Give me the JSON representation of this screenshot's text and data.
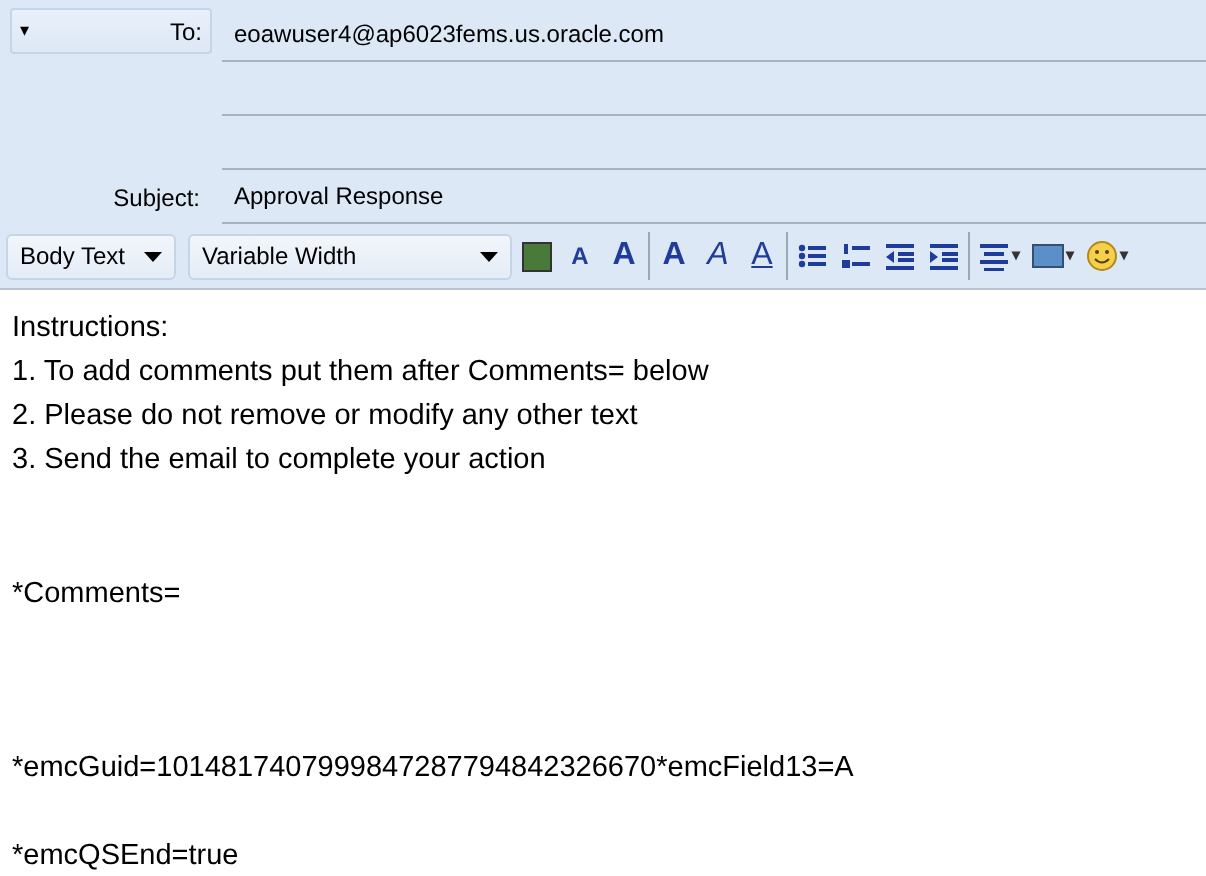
{
  "header": {
    "to_button": {
      "label": "To:",
      "caret": "▾"
    },
    "to_value": "eoawuser4@ap6023fems.us.oracle.com",
    "subject_label": "Subject:",
    "subject_value": "Approval Response"
  },
  "toolbar": [
    {
      "kind": "select",
      "label": "Body Text"
    },
    {
      "kind": "select",
      "label": "Variable Width"
    },
    {
      "kind": "color",
      "color": "#4a7a3a"
    },
    {
      "kind": "glyph",
      "label": "A"
    },
    {
      "kind": "glyph",
      "label": "A"
    },
    {
      "kind": "sep"
    },
    {
      "kind": "glyph",
      "label": "A"
    },
    {
      "kind": "glyph",
      "label": "A"
    },
    {
      "kind": "glyph",
      "label": "A"
    },
    {
      "kind": "sep"
    },
    {
      "kind": "icon"
    },
    {
      "kind": "icon"
    },
    {
      "kind": "icon"
    },
    {
      "kind": "icon"
    },
    {
      "kind": "sep"
    },
    {
      "kind": "icon",
      "caret": "▾"
    },
    {
      "kind": "icon",
      "caret": "▾"
    },
    {
      "kind": "icon",
      "caret": "▾"
    }
  ],
  "body": [
    [
      "Instructions:",
      "1. To add comments put them after Comments= below",
      "2. Please do not remove or modify any other text",
      "3. Send the email to complete your action"
    ],
    [
      "*Comments="
    ],
    [
      "*emcGuid=1014817407999847287794842326670*emcField13=A"
    ],
    [
      "*emcQSEnd=true"
    ]
  ]
}
